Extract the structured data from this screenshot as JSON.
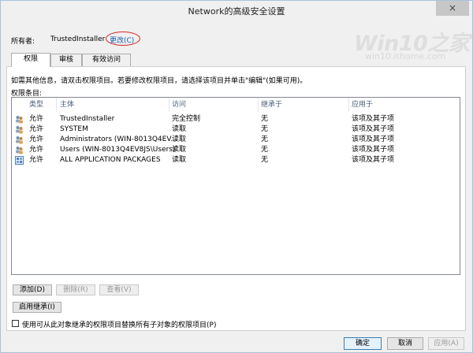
{
  "window": {
    "title": "Network的高级安全设置",
    "close_glyph": "×"
  },
  "owner": {
    "label": "所有者:",
    "value": "TrustedInstaller",
    "change_link": "更改(C)"
  },
  "watermark": {
    "logo": "Win10之家",
    "url": "win10.ithome.com"
  },
  "tabs": [
    {
      "label": "权限",
      "active": true
    },
    {
      "label": "审核",
      "active": false
    },
    {
      "label": "有效访问",
      "active": false
    }
  ],
  "info_text": "如需其他信息，请双击权限项目。若要修改权限项目，请选择该项目并单击\"编辑\"(如果可用)。",
  "entries_label": "权限条目:",
  "columns": [
    "类型",
    "主体",
    "访问",
    "继承于",
    "应用于"
  ],
  "rows": [
    {
      "type": "允许",
      "principal": "TrustedInstaller",
      "access": "完全控制",
      "inherited": "无",
      "applies": "该项及其子项",
      "icon": "user-group-icon"
    },
    {
      "type": "允许",
      "principal": "SYSTEM",
      "access": "读取",
      "inherited": "无",
      "applies": "该项及其子项",
      "icon": "user-group-icon"
    },
    {
      "type": "允许",
      "principal": "Administrators (WIN-8013Q4EV...",
      "access": "读取",
      "inherited": "无",
      "applies": "该项及其子项",
      "icon": "user-group-icon"
    },
    {
      "type": "允许",
      "principal": "Users (WIN-8013Q4EV8JS\\Users)",
      "access": "读取",
      "inherited": "无",
      "applies": "该项及其子项",
      "icon": "user-group-icon"
    },
    {
      "type": "允许",
      "principal": "ALL APPLICATION PACKAGES",
      "access": "读取",
      "inherited": "无",
      "applies": "该项及其子项",
      "icon": "app-packages-icon"
    }
  ],
  "buttons": {
    "add": "添加(D)",
    "remove": "删除(R)",
    "view": "查看(V)",
    "enable_inheritance": "启用继承(I)"
  },
  "checkbox": {
    "label": "使用可从此对象继承的权限项目替换所有子对象的权限项目(P)",
    "checked": false
  },
  "footer": {
    "ok": "确定",
    "cancel": "取消",
    "apply": "应用(A)"
  }
}
